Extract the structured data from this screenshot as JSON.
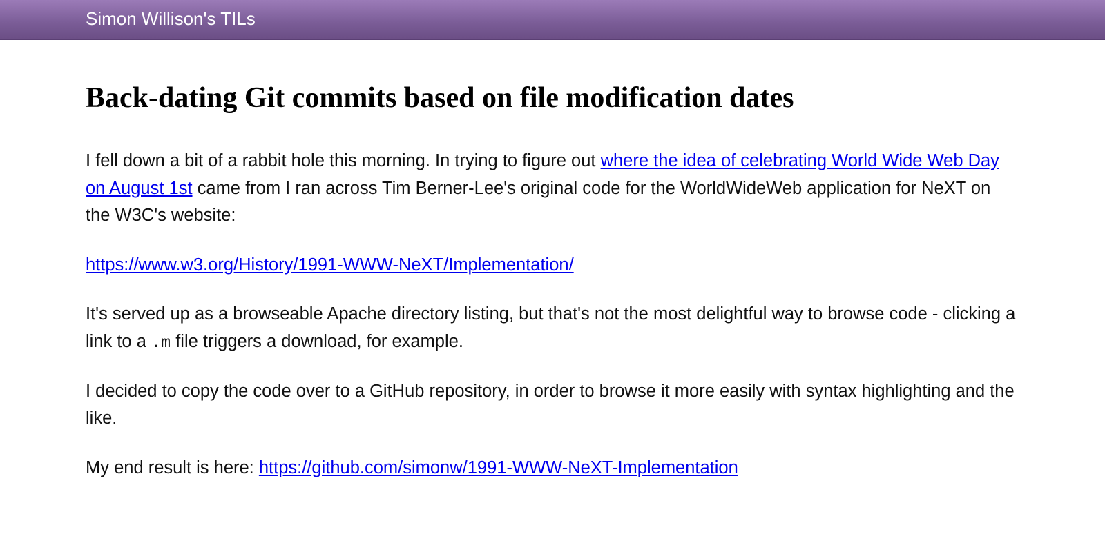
{
  "header": {
    "site_title": "Simon Willison's TILs"
  },
  "article": {
    "title": "Back-dating Git commits based on file modification dates",
    "p1": {
      "t1": "I fell down a bit of a rabbit hole this morning. In trying to figure out ",
      "link1": "where the idea of celebrating World Wide Web Day on August 1st",
      "t2": " came from I ran across Tim Berner-Lee's original code for the WorldWideWeb application for NeXT on the W3C's website:"
    },
    "p2": {
      "link1": "https://www.w3.org/History/1991-WWW-NeXT/Implementation/"
    },
    "p3": {
      "t1": "It's served up as a browseable Apache directory listing, but that's not the most delightful way to browse code - clicking a link to a ",
      "code1": ".m",
      "t2": " file triggers a download, for example."
    },
    "p4": {
      "t1": "I decided to copy the code over to a GitHub repository, in order to browse it more easily with syntax highlighting and the like."
    },
    "p5": {
      "t1": "My end result is here: ",
      "link1": "https://github.com/simonw/1991-WWW-NeXT-Implementation"
    }
  }
}
